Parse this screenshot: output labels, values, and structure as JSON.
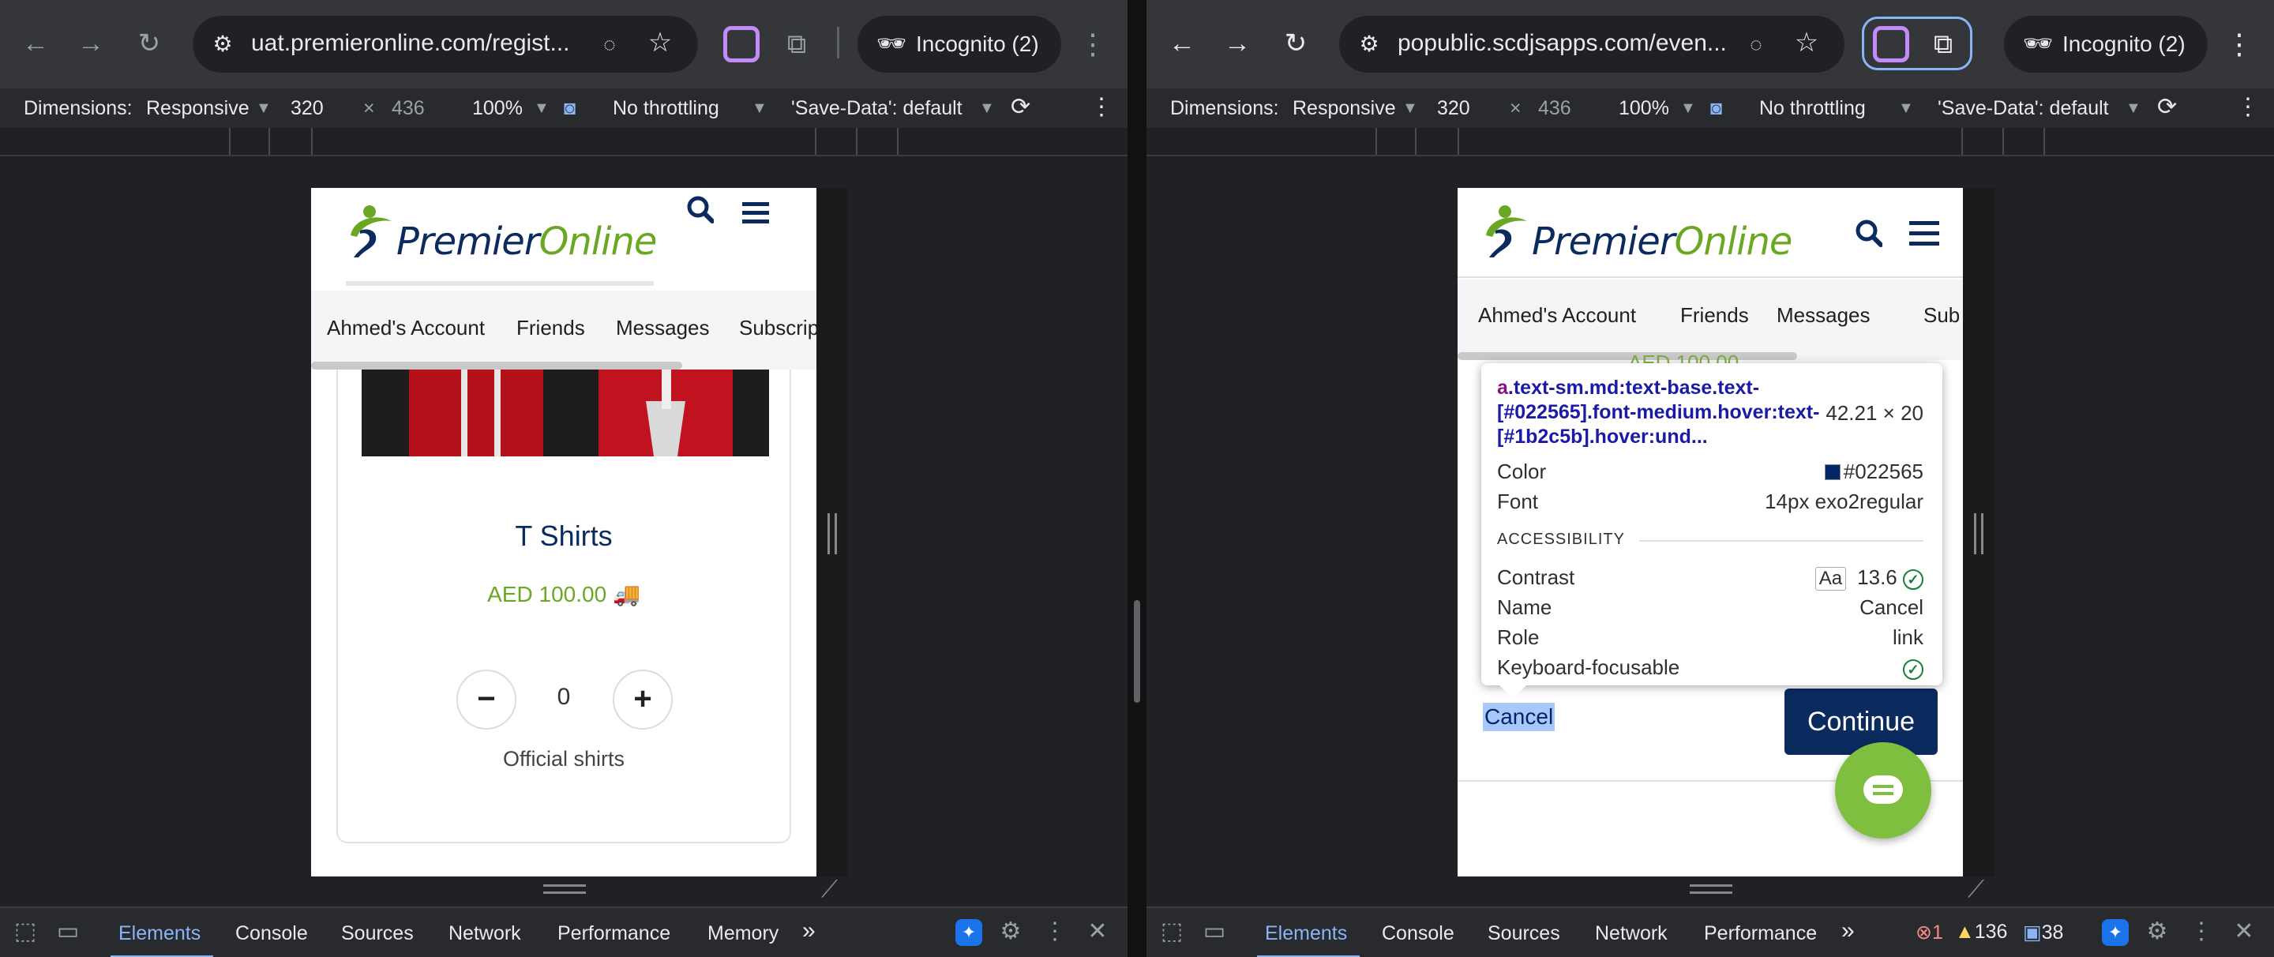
{
  "left": {
    "url": "uat.premieronline.com/regist...",
    "incognito_label": "Incognito (2)",
    "dims": {
      "label": "Dimensions:",
      "mode": "Responsive",
      "width": "320",
      "x": "×",
      "height": "436",
      "zoom": "100%",
      "throttle": "No throttling",
      "savedata": "'Save-Data': default"
    },
    "site": {
      "logo_a": "Premier",
      "logo_b": "Online",
      "tabs": [
        "Ahmed's Account",
        "Friends",
        "Messages",
        "Subscrip"
      ],
      "product": {
        "title": "T Shirts",
        "price": "AED 100.00",
        "qty": "0",
        "minus": "−",
        "plus": "+",
        "desc": "Official shirts"
      }
    },
    "devtools_tabs": [
      "Elements",
      "Console",
      "Sources",
      "Network",
      "Performance",
      "Memory"
    ],
    "more": "»"
  },
  "right": {
    "url": "popublic.scdjsapps.com/even...",
    "incognito_label": "Incognito (2)",
    "dims": {
      "label": "Dimensions:",
      "mode": "Responsive",
      "width": "320",
      "x": "×",
      "height": "436",
      "zoom": "100%",
      "throttle": "No throttling",
      "savedata": "'Save-Data': default"
    },
    "site": {
      "logo_a": "Premier",
      "logo_b": "Online",
      "tabs": [
        "Ahmed's Account",
        "Friends",
        "Messages",
        "Sub"
      ],
      "peek_price": "AED 100.00",
      "cancel": "Cancel",
      "continue": "Continue"
    },
    "inspector": {
      "tag": "a",
      "selector": ".text-sm.md:text-base.text-[#022565].font-medium.hover:text-[#1b2c5b].hover:und...",
      "size": "42.21 × 20",
      "color_label": "Color",
      "color_value": "#022565",
      "color_swatch": "#022565",
      "font_label": "Font",
      "font_value": "14px exo2regular",
      "section": "ACCESSIBILITY",
      "contrast_label": "Contrast",
      "contrast_aa": "Aa",
      "contrast_value": "13.6",
      "name_label": "Name",
      "name_value": "Cancel",
      "role_label": "Role",
      "role_value": "link",
      "kb_label": "Keyboard-focusable"
    },
    "devtools_tabs": [
      "Elements",
      "Console",
      "Sources",
      "Network",
      "Performance"
    ],
    "more": "»",
    "issues": {
      "errors": "1",
      "warnings": "136",
      "messages": "38"
    }
  },
  "colors": {
    "brand_navy": "#0b2a5e",
    "brand_green": "#6aa823",
    "devtools_accent": "#8ab4f8"
  }
}
